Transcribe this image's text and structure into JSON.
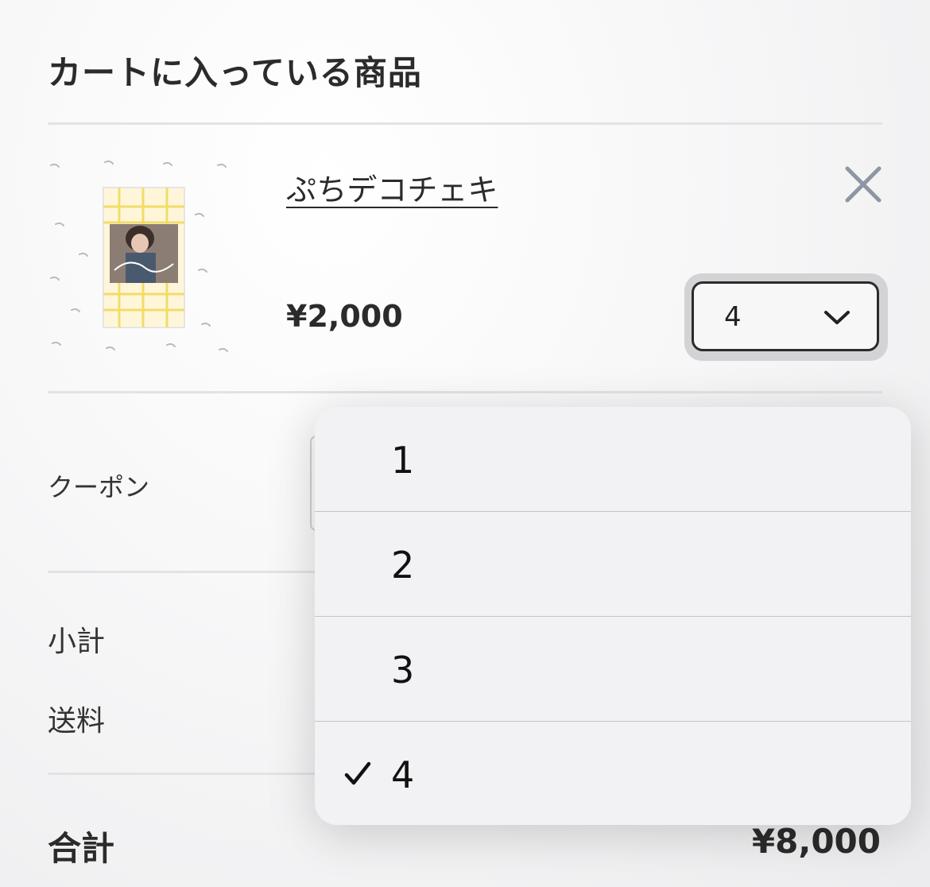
{
  "header": {
    "title": "カートに入っている商品"
  },
  "cart_item": {
    "name": "ぷちデコチェキ",
    "price": "¥2,000",
    "quantity": "4",
    "remove_icon": "close-icon",
    "thumbnail_icon": "product-photo"
  },
  "coupon": {
    "label": "クーポン"
  },
  "summary": {
    "subtotal_label": "小計",
    "shipping_label": "送料",
    "total_label": "合計",
    "total_value": "¥8,000"
  },
  "quantity_menu": {
    "options": [
      "1",
      "2",
      "3",
      "4"
    ],
    "selected": "4"
  },
  "colors": {
    "text": "#2b2b2b",
    "remove_icon": "#8e96a3",
    "menu_background": "#f2f2f4",
    "thumbnail_accent": "#f2dc6a"
  }
}
